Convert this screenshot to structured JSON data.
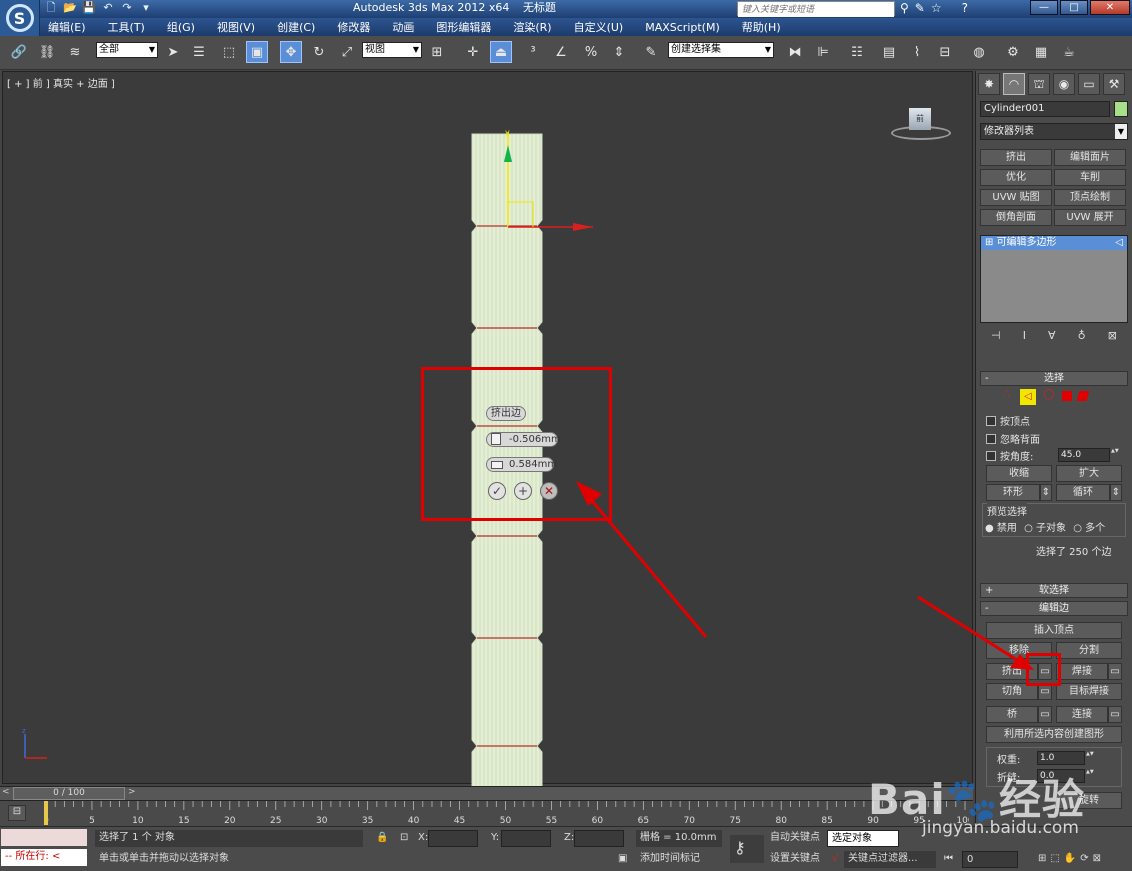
{
  "window": {
    "title": "Autodesk 3ds Max  2012 x64",
    "document": "无标题",
    "search_placeholder": "键入关键字或短语"
  },
  "menu": [
    "编辑(E)",
    "工具(T)",
    "组(G)",
    "视图(V)",
    "创建(C)",
    "修改器",
    "动画",
    "图形编辑器",
    "渲染(R)",
    "自定义(U)",
    "MAXScript(M)",
    "帮助(H)"
  ],
  "toolbar": {
    "selection_filter": "全部",
    "reference_coord": "视图",
    "named_selection": "创建选择集"
  },
  "viewport": {
    "label": "[ + ] 前 ] 真实 + 边面 ]",
    "viewcube_label": "前"
  },
  "caddy": {
    "title": "挤出边",
    "height_value": "-0.506mm",
    "width_value": "0.584mm",
    "ok": "✓",
    "apply": "+",
    "cancel": "✕"
  },
  "timeline": {
    "frame_label": "0 / 100",
    "ticks": [
      "0",
      "5",
      "10",
      "15",
      "20",
      "25",
      "30",
      "35",
      "40",
      "45",
      "50",
      "55",
      "60",
      "65",
      "70",
      "75",
      "80",
      "85",
      "90",
      "95",
      "100"
    ]
  },
  "status": {
    "running_label": "所在行:",
    "selected_text": "选择了 1 个 对象",
    "prompt": "单击或单击并拖动以选择对象",
    "x_label": "X:",
    "y_label": "Y:",
    "z_label": "Z:",
    "grid": "栅格 = 10.0mm",
    "auto_key": "自动关键点",
    "selected_set": "选定对象",
    "set_key": "设置关键点",
    "key_filters": "关键点过滤器...",
    "add_time_tag": "添加时间标记",
    "frame_value": "0"
  },
  "panel": {
    "object_name": "Cylinder001",
    "object_color": "#a8e08a",
    "modifier_list": "修改器列表",
    "quick_buttons": [
      "挤出",
      "编辑面片",
      "优化",
      "车削",
      "UVW 贴图",
      "顶点绘制",
      "倒角剖面",
      "UVW 展开"
    ],
    "stack_item": "可编辑多边形",
    "selection": {
      "title": "选择",
      "by_vertex": "按顶点",
      "ignore_backfacing": "忽略背面",
      "by_angle": "按角度:",
      "angle_value": "45.0",
      "shrink": "收缩",
      "grow": "扩大",
      "ring": "环形",
      "loop": "循环",
      "preview_title": "预览选择",
      "preview_off": "禁用",
      "preview_subobj": "子对象",
      "preview_multi": "多个",
      "selected_info": "选择了 250 个边"
    },
    "soft_selection": "软选择",
    "edit_edges": {
      "title": "编辑边",
      "insert_vertex": "插入顶点",
      "remove": "移除",
      "split": "分割",
      "extrude": "挤出",
      "weld": "焊接",
      "chamfer": "切角",
      "target_weld": "目标焊接",
      "bridge": "桥",
      "connect": "连接",
      "create_shape": "利用所选内容创建图形",
      "weight_label": "权重:",
      "weight_value": "1.0",
      "crease_label": "折缝:",
      "crease_value": "0.0",
      "turn": "旋转"
    }
  },
  "watermark": {
    "brand": "Bai🐾经验",
    "url": "jingyan.baidu.com"
  },
  "colors": {
    "accent": "#5a8ed6",
    "annotation": "#e00000",
    "mesh": "#e8f2d6",
    "highlight_yellow": "#f2e600"
  }
}
